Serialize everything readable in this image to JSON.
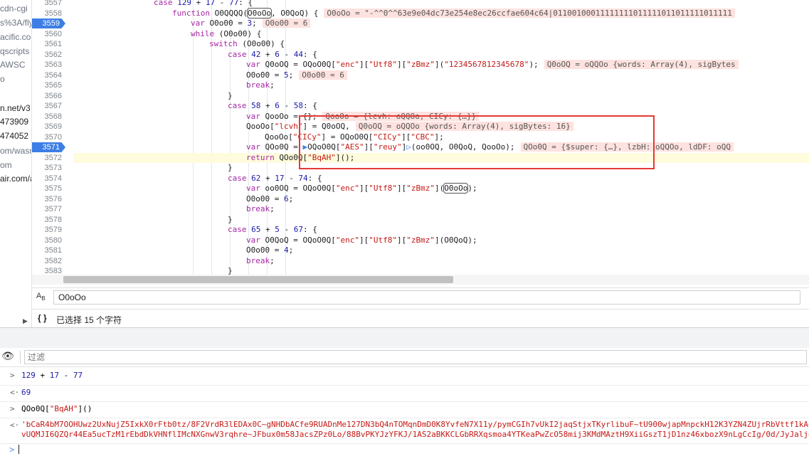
{
  "navigator": {
    "items": [
      {
        "text": "cdn-cgi",
        "style": "muted"
      },
      {
        "text": "s%3A/fly",
        "style": "muted"
      },
      {
        "text": "acific.co",
        "style": "muted"
      },
      {
        "text": "qscripts",
        "style": "muted"
      },
      {
        "text": "AWSC",
        "style": "muted"
      },
      {
        "text": "o",
        "style": "muted"
      },
      {
        "text": "n.net/v3",
        "style": "dark"
      },
      {
        "text": "473909",
        "style": "dark"
      },
      {
        "text": "474052",
        "style": "dark"
      },
      {
        "text": "om/wasn",
        "style": "muted"
      },
      {
        "text": "om",
        "style": "muted"
      },
      {
        "text": "air.com/a",
        "style": "dark"
      }
    ]
  },
  "editor": {
    "line_numbers": [
      "3557",
      "3558",
      "3559",
      "3560",
      "3561",
      "3562",
      "3563",
      "3564",
      "3565",
      "3566",
      "3567",
      "3568",
      "3569",
      "3570",
      "3571",
      "3572",
      "3573",
      "3574",
      "3575",
      "3576",
      "3577",
      "3578",
      "3579",
      "3580",
      "3581",
      "3582",
      "3583"
    ],
    "breakpoint_lines": [
      "3559",
      "3571"
    ],
    "current_line": "3572",
    "lines": [
      {
        "indent": 216,
        "segments": [
          {
            "t": "case ",
            "c": "kw"
          },
          {
            "t": "129",
            "c": "num"
          },
          {
            "t": " + "
          },
          {
            "t": "17",
            "c": "num"
          },
          {
            "t": " - "
          },
          {
            "t": "77",
            "c": "num"
          },
          {
            "t": ": {"
          }
        ]
      },
      {
        "indent": 242,
        "segments": [
          {
            "t": "function ",
            "c": "kw"
          },
          {
            "t": "O0QQQQ("
          },
          {
            "t": "O0oOo",
            "c": "boxed"
          },
          {
            "t": ", O0QoQ) {"
          },
          {
            "t": "O0oOo = \"-^^0^^63e9e04dc73e254e8ec26ccfae604c64|01100100011111111011111011011111011111",
            "c": "inline"
          }
        ]
      },
      {
        "indent": 268,
        "segments": [
          {
            "t": "var ",
            "c": "kw"
          },
          {
            "t": "O0o00 = "
          },
          {
            "t": "3",
            "c": "num"
          },
          {
            "t": ";"
          },
          {
            "t": "O0o00 = 6",
            "c": "inline"
          }
        ]
      },
      {
        "indent": 268,
        "segments": [
          {
            "t": "while ",
            "c": "kw"
          },
          {
            "t": "(O0o00) {"
          }
        ]
      },
      {
        "indent": 294,
        "segments": [
          {
            "t": "switch ",
            "c": "kw"
          },
          {
            "t": "(O0o00) {"
          }
        ]
      },
      {
        "indent": 320,
        "segments": [
          {
            "t": "case ",
            "c": "kw"
          },
          {
            "t": "42",
            "c": "num"
          },
          {
            "t": " + "
          },
          {
            "t": "6",
            "c": "num"
          },
          {
            "t": " - "
          },
          {
            "t": "44",
            "c": "num"
          },
          {
            "t": ": {"
          }
        ]
      },
      {
        "indent": 346,
        "segments": [
          {
            "t": "var ",
            "c": "kw"
          },
          {
            "t": "Q0oOQ = OQoO0Q["
          },
          {
            "t": "\"enc\"",
            "c": "str"
          },
          {
            "t": "]["
          },
          {
            "t": "\"Utf8\"",
            "c": "str"
          },
          {
            "t": "]["
          },
          {
            "t": "\"zBmz\"",
            "c": "str"
          },
          {
            "t": "]("
          },
          {
            "t": "\"1234567812345678\"",
            "c": "str"
          },
          {
            "t": ");"
          },
          {
            "t": "Q0oOQ = oQQOo {words: Array(4), sigBytes",
            "c": "inline"
          }
        ]
      },
      {
        "indent": 346,
        "segments": [
          {
            "t": "O0o00 = "
          },
          {
            "t": "5",
            "c": "num"
          },
          {
            "t": ";"
          },
          {
            "t": "O0o00 = 6",
            "c": "inline"
          }
        ]
      },
      {
        "indent": 346,
        "segments": [
          {
            "t": "break",
            "c": "kw"
          },
          {
            "t": ";"
          }
        ]
      },
      {
        "indent": 320,
        "segments": [
          {
            "t": "}"
          }
        ]
      },
      {
        "indent": 320,
        "segments": [
          {
            "t": "case ",
            "c": "kw"
          },
          {
            "t": "58",
            "c": "num"
          },
          {
            "t": " + "
          },
          {
            "t": "6",
            "c": "num"
          },
          {
            "t": " - "
          },
          {
            "t": "58",
            "c": "num"
          },
          {
            "t": ": {"
          }
        ]
      },
      {
        "indent": 346,
        "segments": [
          {
            "t": "var ",
            "c": "kw"
          },
          {
            "t": "QooOo = {};"
          },
          {
            "t": "QooOo = {lcvh: oQQOo, CICy: {…}}",
            "c": "inline"
          }
        ]
      },
      {
        "indent": 346,
        "segments": [
          {
            "t": "QooOo["
          },
          {
            "t": "\"lcvh\"",
            "c": "str"
          },
          {
            "t": "] = Q0oOQ,"
          },
          {
            "t": "Q0oOQ = oQQOo {words: Array(4), sigBytes: 16}",
            "c": "inline"
          }
        ]
      },
      {
        "indent": 372,
        "segments": [
          {
            "t": "QooOo["
          },
          {
            "t": "\"CICy\"",
            "c": "str"
          },
          {
            "t": "] = OQoO0Q["
          },
          {
            "t": "\"CICy\"",
            "c": "str"
          },
          {
            "t": "]["
          },
          {
            "t": "\"CBC\"",
            "c": "str"
          },
          {
            "t": "];"
          }
        ]
      },
      {
        "indent": 346,
        "segments": [
          {
            "t": "var ",
            "c": "kw"
          },
          {
            "t": "QOo0Q = "
          },
          {
            "t": "▶",
            "c": "pause"
          },
          {
            "t": "OQoO0Q["
          },
          {
            "t": "\"AES\"",
            "c": "str"
          },
          {
            "t": "]["
          },
          {
            "t": "\"reuy\"",
            "c": "str"
          },
          {
            "t": "]"
          },
          {
            "t": "▷",
            "c": "pause"
          },
          {
            "t": "(oo0OQ, O0QoQ, QooOo);"
          },
          {
            "t": "QOo0Q = {$super: {…}, lzbH: oQQOo, ldDF: oQQ",
            "c": "inline"
          }
        ]
      },
      {
        "indent": 346,
        "segments": [
          {
            "t": "return ",
            "c": "kw"
          },
          {
            "t": "QOo0Q["
          },
          {
            "t": "\"BqAH\"",
            "c": "str"
          },
          {
            "t": "]();"
          }
        ]
      },
      {
        "indent": 320,
        "segments": [
          {
            "t": "}"
          }
        ]
      },
      {
        "indent": 320,
        "segments": [
          {
            "t": "case ",
            "c": "kw"
          },
          {
            "t": "62",
            "c": "num"
          },
          {
            "t": " + "
          },
          {
            "t": "17",
            "c": "num"
          },
          {
            "t": " - "
          },
          {
            "t": "74",
            "c": "num"
          },
          {
            "t": ": {"
          }
        ]
      },
      {
        "indent": 346,
        "segments": [
          {
            "t": "var ",
            "c": "kw"
          },
          {
            "t": "oo0OQ = OQoO0Q["
          },
          {
            "t": "\"enc\"",
            "c": "str"
          },
          {
            "t": "]["
          },
          {
            "t": "\"Utf8\"",
            "c": "str"
          },
          {
            "t": "]["
          },
          {
            "t": "\"zBmz\"",
            "c": "str"
          },
          {
            "t": "]("
          },
          {
            "t": "O0oOo",
            "c": "boxed"
          },
          {
            "t": ");"
          }
        ]
      },
      {
        "indent": 346,
        "segments": [
          {
            "t": "O0o00 = "
          },
          {
            "t": "6",
            "c": "num"
          },
          {
            "t": ";"
          }
        ]
      },
      {
        "indent": 346,
        "segments": [
          {
            "t": "break",
            "c": "kw"
          },
          {
            "t": ";"
          }
        ]
      },
      {
        "indent": 320,
        "segments": [
          {
            "t": "}"
          }
        ]
      },
      {
        "indent": 320,
        "segments": [
          {
            "t": "case ",
            "c": "kw"
          },
          {
            "t": "65",
            "c": "num"
          },
          {
            "t": " + "
          },
          {
            "t": "5",
            "c": "num"
          },
          {
            "t": " - "
          },
          {
            "t": "67",
            "c": "num"
          },
          {
            "t": ": {"
          }
        ]
      },
      {
        "indent": 346,
        "segments": [
          {
            "t": "var ",
            "c": "kw"
          },
          {
            "t": "O0QoQ = OQoO0Q["
          },
          {
            "t": "\"enc\"",
            "c": "str"
          },
          {
            "t": "]["
          },
          {
            "t": "\"Utf8\"",
            "c": "str"
          },
          {
            "t": "]["
          },
          {
            "t": "\"zBmz\"",
            "c": "str"
          },
          {
            "t": "](O0QoQ);"
          }
        ]
      },
      {
        "indent": 346,
        "segments": [
          {
            "t": "O0o00 = "
          },
          {
            "t": "4",
            "c": "num"
          },
          {
            "t": ";"
          }
        ]
      },
      {
        "indent": 346,
        "segments": [
          {
            "t": "break",
            "c": "kw"
          },
          {
            "t": ";"
          }
        ]
      },
      {
        "indent": 320,
        "segments": [
          {
            "t": "}"
          }
        ]
      }
    ]
  },
  "search": {
    "case_icon": "match-case-icon",
    "value": "O0oOo"
  },
  "status": {
    "selection_text": "已选择 15 个字符",
    "braces_label": "{ }"
  },
  "console": {
    "filter_placeholder": "过滤",
    "entries": [
      {
        "type": "input",
        "prefix": ">",
        "segments": [
          {
            "t": "129",
            "c": "num"
          },
          {
            "t": " + "
          },
          {
            "t": "17",
            "c": "num"
          },
          {
            "t": " - "
          },
          {
            "t": "77",
            "c": "num"
          }
        ]
      },
      {
        "type": "result",
        "prefix": "<·",
        "segments": [
          {
            "t": "69",
            "c": "num"
          }
        ]
      },
      {
        "type": "input",
        "prefix": ">",
        "segments": [
          {
            "t": "QOo0Q["
          },
          {
            "t": "\"BqAH\"",
            "c": "str"
          },
          {
            "t": "]()"
          }
        ]
      },
      {
        "type": "result",
        "prefix": "<·",
        "lines": [
          "'bCaR4bM7OOHUwz2UxNujZ5IxkX0rFtb0tz/8F2VrdR3lEDAx0C~gNHDbACfe9RUADnMe127DN3bQ4nTOMqnDmD0K8YvfeN7X11y/pymCGIh7vUkI2jaqStjxTKyrlibuF~tU900wjapMnpckH12K3YZN4ZUjrRbVttf1kAo",
          "vUQMJI6QZQr44Ea5ucTzM1rEbdDkVHNflIMcNXGnwV3rqhre~JFbux0m58JacsZPz0Lo/88BvPKYJzYFKJ/1AS2aBKKCLGbRRXqsmoa4YTKeaPwZcO58mij3KMdMAztH9XiiGszT1jD1nz46xbozX9nLgCcIg/0d/JyJaljg"
        ]
      }
    ],
    "prompt_symbol": ">"
  }
}
